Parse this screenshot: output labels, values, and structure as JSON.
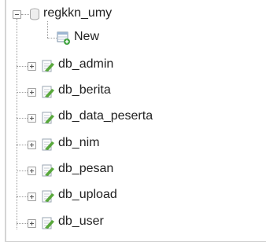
{
  "tree": {
    "database": {
      "name": "regkkn_umy",
      "new_label": "New",
      "tables": [
        "db_admin",
        "db_berita",
        "db_data_peserta",
        "db_nim",
        "db_pesan",
        "db_upload",
        "db_user"
      ]
    }
  },
  "icons": {
    "database": "database-icon",
    "new": "new-table-icon",
    "table": "table-structure-icon"
  },
  "colors": {
    "guide_lines": "#9a9a9a",
    "text": "#222222",
    "new_icon_accent": "#3fa33f",
    "table_icon_accent": "#58a83b"
  }
}
